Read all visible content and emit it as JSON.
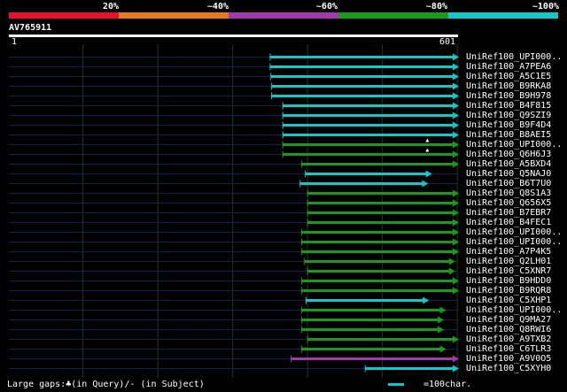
{
  "legend": {
    "labels": [
      "20%",
      "~40%",
      "~60%",
      "~80%",
      "~100%"
    ],
    "colors": [
      "#e8102a",
      "#e87a1e",
      "#a13aa8",
      "#1a9a1a",
      "#14c8c8"
    ]
  },
  "query": {
    "name": "AV765911",
    "start": "1",
    "end": "601",
    "length": 601
  },
  "hits": [
    {
      "name": "UniRef100_UPI000..",
      "start": 350,
      "end": 601,
      "color": "#14c8c8",
      "arrow": true
    },
    {
      "name": "UniRef100_A7PEA6",
      "start": 350,
      "end": 601,
      "color": "#14c8c8",
      "arrow": true
    },
    {
      "name": "UniRef100_A5C1E5",
      "start": 351,
      "end": 601,
      "color": "#14c8c8",
      "arrow": true
    },
    {
      "name": "UniRef100_B9RKA8",
      "start": 352,
      "end": 601,
      "color": "#14c8c8",
      "arrow": true
    },
    {
      "name": "UniRef100_B9H978",
      "start": 352,
      "end": 601,
      "color": "#14c8c8",
      "arrow": true
    },
    {
      "name": "UniRef100_B4F815",
      "start": 367,
      "end": 601,
      "color": "#14c8c8",
      "arrow": true
    },
    {
      "name": "UniRef100_Q9SZI9",
      "start": 367,
      "end": 601,
      "color": "#14c8c8",
      "arrow": true
    },
    {
      "name": "UniRef100_B9F4D4",
      "start": 367,
      "end": 601,
      "color": "#14c8c8",
      "arrow": true
    },
    {
      "name": "UniRef100_B8AEI5",
      "start": 367,
      "end": 601,
      "color": "#14c8c8",
      "arrow": true
    },
    {
      "name": "UniRef100_UPI000..",
      "start": 367,
      "end": 601,
      "color": "#1a9a1a",
      "arrow": true,
      "gap": 560
    },
    {
      "name": "UniRef100_Q6H6J3",
      "start": 367,
      "end": 601,
      "color": "#1a9a1a",
      "arrow": true,
      "gap": 560
    },
    {
      "name": "UniRef100_A5BXD4",
      "start": 392,
      "end": 601,
      "color": "#1a9a1a",
      "arrow": true
    },
    {
      "name": "UniRef100_Q5NAJ0",
      "start": 397,
      "end": 565,
      "color": "#14c8c8",
      "arrow": true
    },
    {
      "name": "UniRef100_B6T7U0",
      "start": 390,
      "end": 560,
      "color": "#14c8c8",
      "arrow": true
    },
    {
      "name": "UniRef100_Q8S1A3",
      "start": 400,
      "end": 601,
      "color": "#1a9a1a",
      "arrow": true
    },
    {
      "name": "UniRef100_Q656X5",
      "start": 400,
      "end": 601,
      "color": "#1a9a1a",
      "arrow": true
    },
    {
      "name": "UniRef100_B7EBR7",
      "start": 400,
      "end": 601,
      "color": "#1a9a1a",
      "arrow": true
    },
    {
      "name": "UniRef100_B4FEC1",
      "start": 400,
      "end": 601,
      "color": "#1a9a1a",
      "arrow": true
    },
    {
      "name": "UniRef100_UPI000..",
      "start": 392,
      "end": 601,
      "color": "#1a9a1a",
      "arrow": true
    },
    {
      "name": "UniRef100_UPI000..",
      "start": 392,
      "end": 601,
      "color": "#1a9a1a",
      "arrow": true
    },
    {
      "name": "UniRef100_A7P4K5",
      "start": 392,
      "end": 601,
      "color": "#1a9a1a",
      "arrow": true
    },
    {
      "name": "UniRef100_Q2LH01",
      "start": 396,
      "end": 596,
      "color": "#1a9a1a",
      "arrow": true
    },
    {
      "name": "UniRef100_C5XNR7",
      "start": 400,
      "end": 596,
      "color": "#1a9a1a",
      "arrow": true
    },
    {
      "name": "UniRef100_B9HDD0",
      "start": 392,
      "end": 601,
      "color": "#1a9a1a",
      "arrow": true
    },
    {
      "name": "UniRef100_B9RQR8",
      "start": 392,
      "end": 601,
      "color": "#1a9a1a",
      "arrow": true
    },
    {
      "name": "UniRef100_C5XHP1",
      "start": 398,
      "end": 561,
      "color": "#14c8c8",
      "arrow": true
    },
    {
      "name": "UniRef100_UPI000..",
      "start": 392,
      "end": 584,
      "color": "#1a9a1a",
      "arrow": true
    },
    {
      "name": "UniRef100_Q9MA27",
      "start": 392,
      "end": 581,
      "color": "#1a9a1a",
      "arrow": true
    },
    {
      "name": "UniRef100_Q8RWI6",
      "start": 392,
      "end": 581,
      "color": "#1a9a1a",
      "arrow": true
    },
    {
      "name": "UniRef100_A9TXB2",
      "start": 400,
      "end": 601,
      "color": "#1a9a1a",
      "arrow": true
    },
    {
      "name": "UniRef100_C6TLR3",
      "start": 392,
      "end": 584,
      "color": "#1a9a1a",
      "arrow": true
    },
    {
      "name": "UniRef100_A9V0O5",
      "start": 378,
      "end": 601,
      "color": "#a13aa8",
      "arrow": true
    },
    {
      "name": "UniRef100_C5XYH0",
      "start": 477,
      "end": 601,
      "color": "#14c8c8",
      "arrow": true
    }
  ],
  "footer": {
    "gaps_text": "Large gaps:♣(in Query)/- (in Subject)",
    "scale_text": "=100char."
  }
}
